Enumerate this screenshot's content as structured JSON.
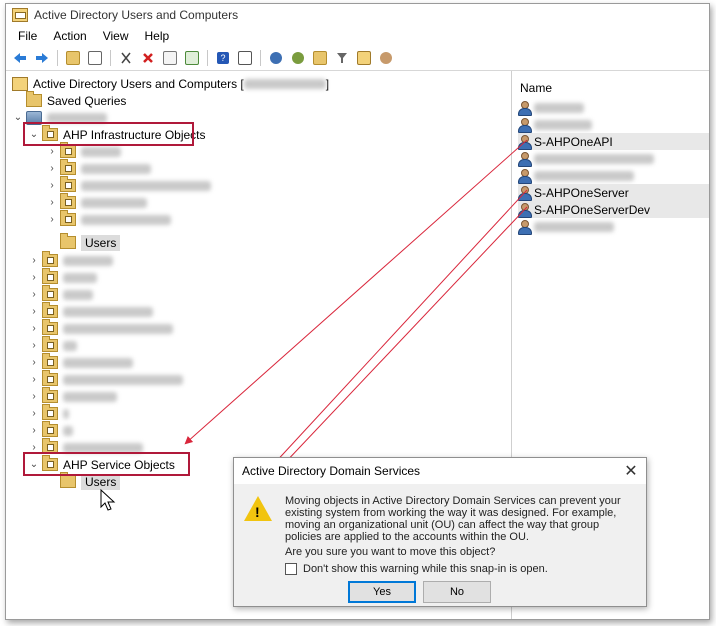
{
  "window": {
    "title": "Active Directory Users and Computers"
  },
  "menu": [
    {
      "label": "File"
    },
    {
      "label": "Action"
    },
    {
      "label": "View"
    },
    {
      "label": "Help"
    }
  ],
  "tree": {
    "root_label": "Active Directory Users and Computers [",
    "root_suffix": "]",
    "saved_queries": "Saved Queries",
    "infra_ou": "AHP Infrastructure Objects",
    "infra_users": "Users",
    "service_ou": "AHP Service Objects",
    "service_users": "Users"
  },
  "list": {
    "header": "Name",
    "items": [
      {
        "name": "",
        "blurred": true
      },
      {
        "name": "",
        "blurred": true
      },
      {
        "name": "S-AHPOneAPI",
        "blurred": false
      },
      {
        "name": "",
        "blurred": true
      },
      {
        "name": "",
        "blurred": true
      },
      {
        "name": "S-AHPOneServer",
        "blurred": false
      },
      {
        "name": "S-AHPOneServerDev",
        "blurred": false
      },
      {
        "name": "",
        "blurred": true
      }
    ]
  },
  "dialog": {
    "title": "Active Directory Domain Services",
    "message": "Moving objects in Active Directory Domain Services can prevent your existing system from working the way it was designed. For example, moving an organizational unit (OU) can affect the way that group policies are applied to the accounts within the OU.",
    "question": "Are you sure you want to move this object?",
    "checkbox_label": "Don't show this warning while this snap-in is open.",
    "checkbox_checked": false,
    "yes_label": "Yes",
    "no_label": "No"
  },
  "colors": {
    "highlight": "#b0193a",
    "arrow": "#d9263b"
  }
}
